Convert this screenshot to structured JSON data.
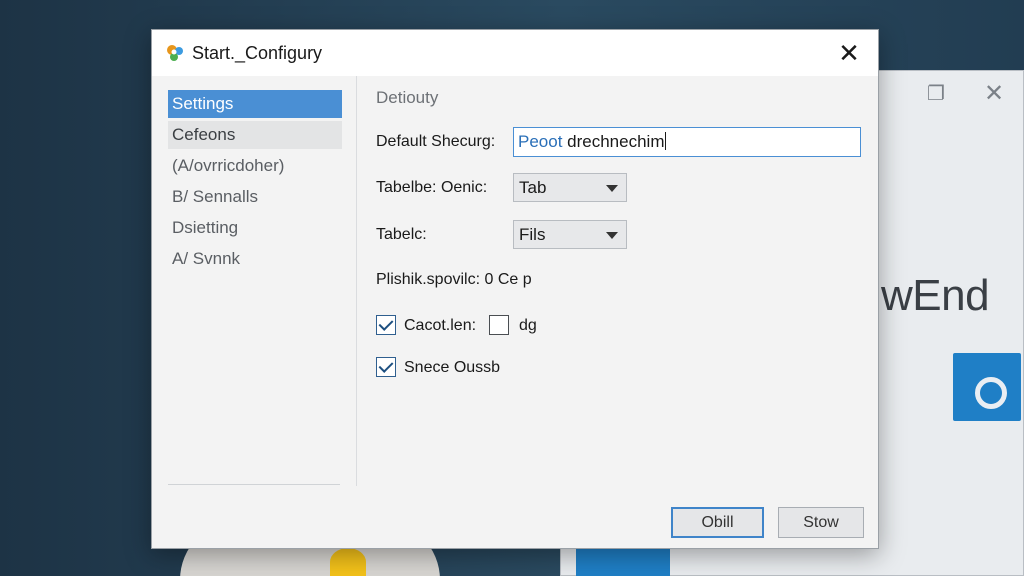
{
  "dialog": {
    "title": "Start._Configury",
    "close_glyph": "✕"
  },
  "nav": {
    "items": [
      {
        "label": "Settings",
        "state": "selected"
      },
      {
        "label": "Cefeons",
        "state": "hover"
      },
      {
        "label": "(A/ovrricdoher)",
        "state": "normal"
      },
      {
        "label": "B/ Sennalls",
        "state": "normal"
      },
      {
        "label": "Dsietting",
        "state": "normal"
      },
      {
        "label": "A/ Svnnk",
        "state": "normal"
      }
    ]
  },
  "content": {
    "section_title": "Detiouty",
    "default_field": {
      "label": "Default Shecurg:",
      "value_highlight": "Peoot",
      "value_rest": " drechnechim"
    },
    "select1": {
      "label": "Tabelbe: Oenic:",
      "value": "Tab"
    },
    "select2": {
      "label": "Tabelc:",
      "value": "Fils"
    },
    "info_line": "Plishik.spovilc: 0  Ce p",
    "checkbox1": {
      "label": "Cacot.len:",
      "checked": true,
      "extra_label": "dg",
      "extra_checked": false
    },
    "checkbox2": {
      "label": "Snece Oussb",
      "checked": true
    }
  },
  "buttons": {
    "primary": "Obill",
    "secondary": "Stow"
  },
  "background": {
    "window_text": "wEnd",
    "maximize_glyph": "❐",
    "close_glyph": "✕"
  },
  "colors": {
    "accent": "#4a8fd4",
    "selected_text": "#ffffff",
    "desktop": "#1f3a4f"
  }
}
